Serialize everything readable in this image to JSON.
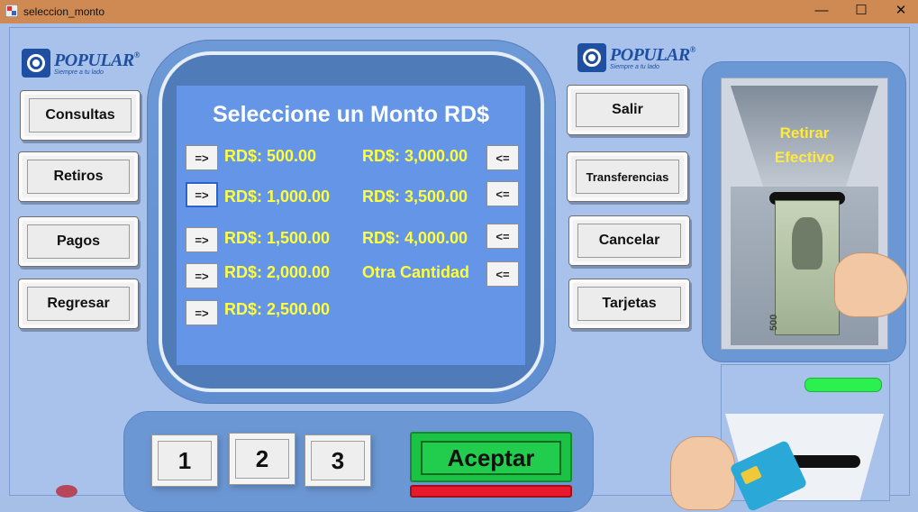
{
  "window": {
    "title": "seleccion_monto",
    "controls": [
      "—",
      "☐",
      "✕"
    ]
  },
  "logos": {
    "left": {
      "name": "POPULAR",
      "tagline": "Siempre a tu lado"
    },
    "right": {
      "name": "POPULAR",
      "tagline": "Siempre a tu lado"
    }
  },
  "left_menu": {
    "items": [
      {
        "label": "Consultas"
      },
      {
        "label": "Retiros"
      },
      {
        "label": "Pagos"
      },
      {
        "label": "Regresar"
      }
    ]
  },
  "right_menu": {
    "items": [
      {
        "label": "Salir"
      },
      {
        "label": "Transferencias"
      },
      {
        "label": "Cancelar"
      },
      {
        "label": "Tarjetas"
      }
    ]
  },
  "screen": {
    "heading": "Seleccione un Monto RD$",
    "left_amounts": [
      "RD$: 500.00",
      "RD$: 1,000.00",
      "RD$: 1,500.00",
      "RD$: 2,000.00",
      "RD$: 2,500.00"
    ],
    "right_amounts": [
      "RD$: 3,000.00",
      "RD$: 3,500.00",
      "RD$: 4,000.00",
      "Otra Cantidad"
    ],
    "left_arrow": "=>",
    "right_arrow": "<="
  },
  "keypad": {
    "keys": [
      "1",
      "2",
      "3"
    ],
    "accept_label": "Aceptar"
  },
  "cash_dispenser": {
    "label_line1": "Retirar",
    "label_line2": "Efectivo",
    "bill_value": "500"
  },
  "colors": {
    "accent_green": "#1bc345",
    "amount_yellow": "#ffff3a",
    "screen_blue": "#6495e6"
  }
}
